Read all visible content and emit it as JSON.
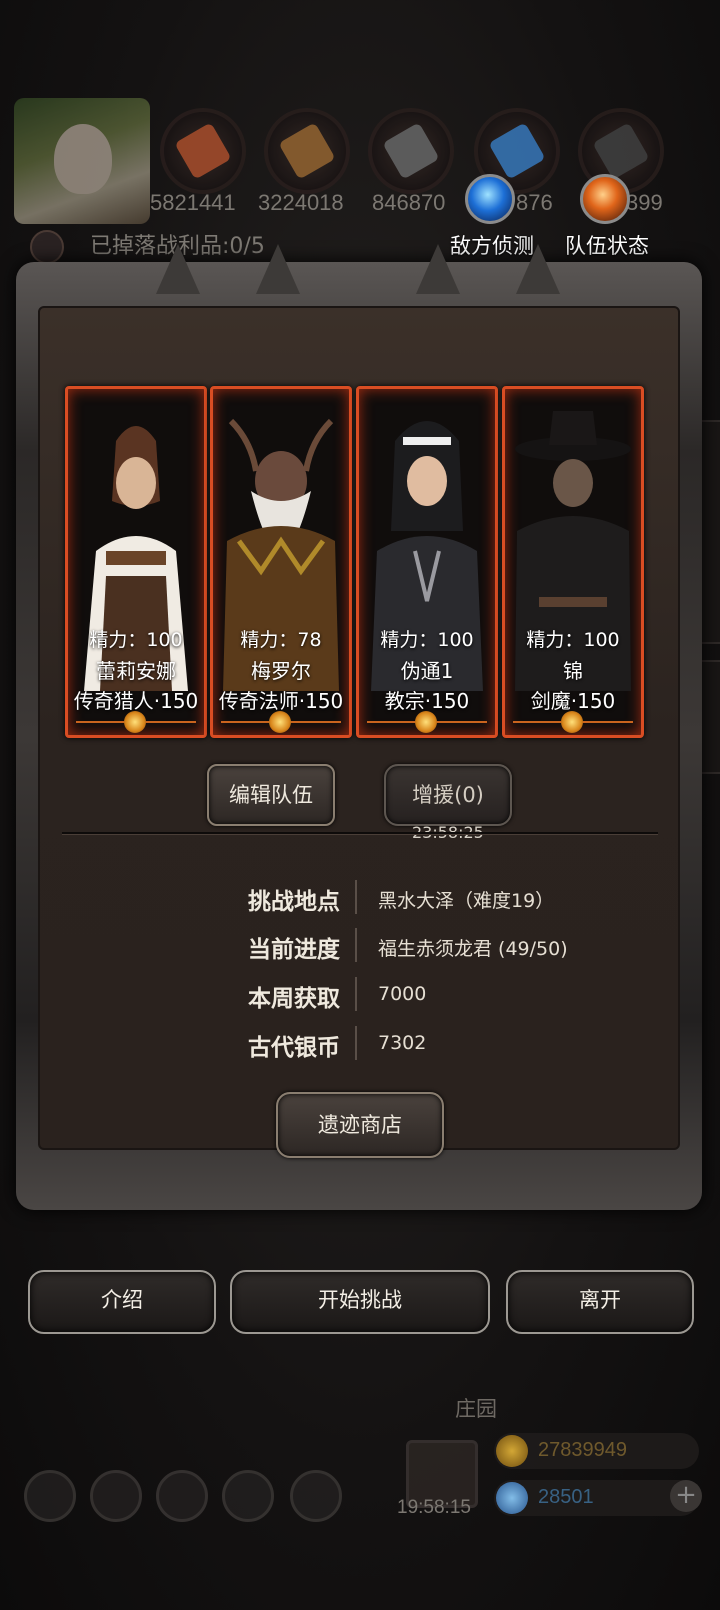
{
  "resources": {
    "values": [
      "5821441",
      "3224018",
      "846870",
      "876",
      "399"
    ],
    "icons": [
      "meat-icon",
      "wood-icon",
      "stone-icon",
      "crystal-icon",
      "iron-icon"
    ]
  },
  "loot_text": "已掉落战利品:0/5",
  "top_buttons": {
    "enemy_scout": "敌方侦测",
    "team_status": "队伍状态"
  },
  "heroes": [
    {
      "energy": "精力：100",
      "name": "蕾莉安娜",
      "class_level": "传奇猎人·150"
    },
    {
      "energy": "精力：78",
      "name": "梅罗尔",
      "class_level": "传奇法师·150"
    },
    {
      "energy": "精力：100",
      "name": "伪通1",
      "class_level": "教宗·150"
    },
    {
      "energy": "精力：100",
      "name": "锦",
      "class_level": "剑魔·150"
    }
  ],
  "team": {
    "edit_label": "编辑队伍",
    "reinforce_label": "增援(0)",
    "reinforce_timer": "23:58:25"
  },
  "info": [
    {
      "key": "挑战地点",
      "value": "黑水大泽（难度19）"
    },
    {
      "key": "当前进度",
      "value": "福生赤须龙君 (49/50)"
    },
    {
      "key": "本周获取",
      "value": "7000"
    },
    {
      "key": "古代银币",
      "value": "7302"
    }
  ],
  "shop_label": "遗迹商店",
  "actions": {
    "intro": "介绍",
    "start": "开始挑战",
    "leave": "离开"
  },
  "hub": {
    "title": "庄园",
    "timer": "19:58:15",
    "gold": "27839949",
    "gems": "28501"
  },
  "colors": {
    "card_border": "#d94d23",
    "gold_text": "#c8a23a",
    "gem_text": "#5fa0d6"
  }
}
